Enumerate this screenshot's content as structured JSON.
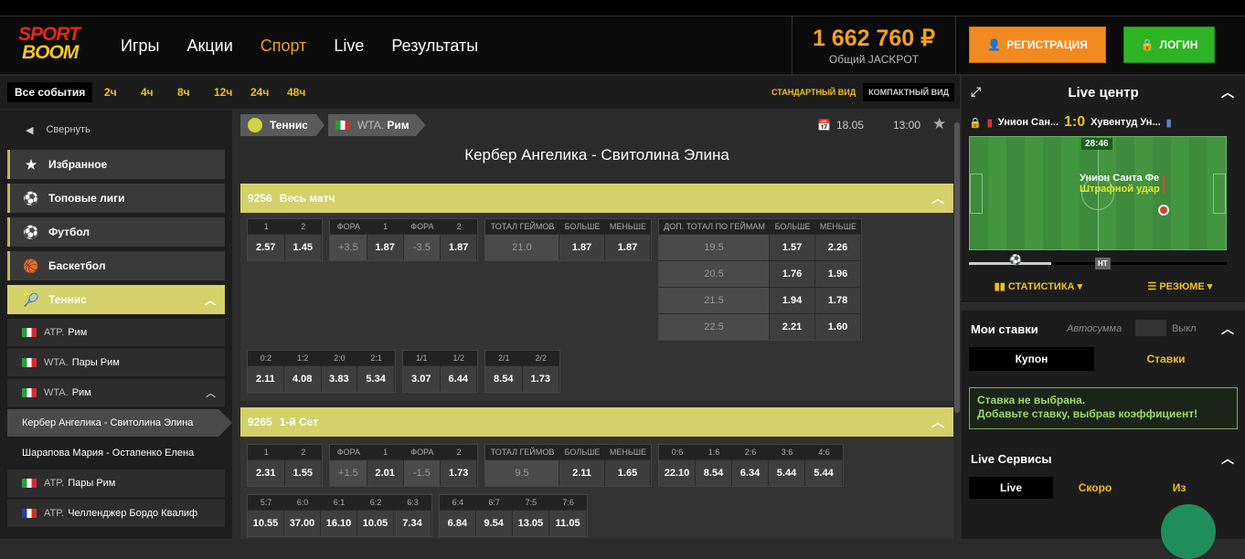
{
  "brand": {
    "line1": "SPORT",
    "line2": "BOOM"
  },
  "nav": {
    "items": [
      {
        "label": "Игры",
        "active": false
      },
      {
        "label": "Акции",
        "active": false
      },
      {
        "label": "Спорт",
        "active": true
      },
      {
        "label": "Live",
        "active": false
      },
      {
        "label": "Результаты",
        "active": false
      }
    ]
  },
  "jackpot": {
    "amount": "1 662 760 ₽",
    "label": "Общий JACKPOT"
  },
  "auth": {
    "register": "РЕГИСТРАЦИЯ",
    "login": "ЛОГИН"
  },
  "filter": {
    "all": "Все события",
    "hours": [
      "2ч",
      "4ч",
      "8ч",
      "12ч",
      "24ч",
      "48ч"
    ],
    "std_view": "СТАНДАРТНЫЙ ВИД",
    "compact_view": "КОМПАКТНЫЙ ВИД"
  },
  "sidebar": {
    "collapse": "Свернуть",
    "items": [
      {
        "label": "Избранное",
        "icon": "star-icon"
      },
      {
        "label": "Топовые лиги",
        "icon": "soccer-ball-icon"
      },
      {
        "label": "Футбол",
        "icon": "soccer-ball-icon"
      },
      {
        "label": "Баскетбол",
        "icon": "basketball-icon"
      },
      {
        "label": "Теннис",
        "icon": "tennis-ball-icon"
      }
    ],
    "sub": [
      {
        "pre": "ATP.",
        "label": "Рим"
      },
      {
        "pre": "WTA.",
        "label": "Пары Рим"
      },
      {
        "pre": "WTA.",
        "label": "Рим"
      }
    ],
    "matches": [
      "Кербер Ангелика - Свитолина Элина",
      "Шарапова Мария - Остапенко Елена"
    ],
    "sub2": [
      {
        "pre": "ATP.",
        "label": "Пары Рим"
      },
      {
        "pre": "ATP.",
        "label": "Челленджер Бордо Квалиф"
      }
    ]
  },
  "match": {
    "crumb_sport": "Теннис",
    "crumb_league_pre": "WTA.",
    "crumb_league": "Рим",
    "date": "18.05",
    "time": "13:00",
    "title": "Кербер Ангелика - Свитолина Элина",
    "markets": [
      {
        "id": "9256",
        "name": "Весь матч"
      },
      {
        "id": "9265",
        "name": "1-й Сет"
      }
    ]
  },
  "m1": {
    "g1": {
      "h": [
        "1",
        "2"
      ],
      "v": [
        "2.57",
        "1.45"
      ]
    },
    "g2": {
      "h": [
        "ФОРА",
        "1",
        "ФОРА",
        "2"
      ],
      "v": [
        "+3.5",
        "1.87",
        "-3.5",
        "1.87"
      ]
    },
    "g3": {
      "h": [
        "ТОТАЛ ГЕЙМОВ",
        "БОЛЬШЕ",
        "МЕНЬШЕ"
      ],
      "v": [
        "21.0",
        "1.87",
        "1.87"
      ]
    },
    "g4": {
      "h": [
        "ДОП. ТОТАЛ ПО ГЕЙМАМ",
        "БОЛЬШЕ",
        "МЕНЬШЕ"
      ],
      "rows": [
        [
          "19.5",
          "1.57",
          "2.26"
        ],
        [
          "20.5",
          "1.76",
          "1.96"
        ],
        [
          "21.5",
          "1.94",
          "1.78"
        ],
        [
          "22.5",
          "2.21",
          "1.60"
        ]
      ]
    },
    "g5": {
      "h": [
        "0:2",
        "1:2",
        "2:0",
        "2:1"
      ],
      "v": [
        "2.11",
        "4.08",
        "3.83",
        "5.34"
      ]
    },
    "g6": {
      "h": [
        "1/1",
        "1/2"
      ],
      "v": [
        "3.07",
        "6.44"
      ]
    },
    "g7": {
      "h": [
        "2/1",
        "2/2"
      ],
      "v": [
        "8.54",
        "1.73"
      ]
    }
  },
  "m2": {
    "g1": {
      "h": [
        "1",
        "2"
      ],
      "v": [
        "2.31",
        "1.55"
      ]
    },
    "g2": {
      "h": [
        "ФОРА",
        "1",
        "ФОРА",
        "2"
      ],
      "v": [
        "+1.5",
        "2.01",
        "-1.5",
        "1.73"
      ]
    },
    "g3": {
      "h": [
        "ТОТАЛ ГЕЙМОВ",
        "БОЛЬШЕ",
        "МЕНЬШЕ"
      ],
      "v": [
        "9.5",
        "2.11",
        "1.65"
      ]
    },
    "g4": {
      "h": [
        "0:6",
        "1:6",
        "2:6",
        "3:6",
        "4:6"
      ],
      "v": [
        "22.10",
        "8.54",
        "6.34",
        "5.44",
        "5.44"
      ]
    },
    "g5": {
      "h": [
        "5:7",
        "6:0",
        "6:1",
        "6:2",
        "6:3"
      ],
      "v": [
        "10.55",
        "37.00",
        "16.10",
        "10.05",
        "7.34"
      ]
    },
    "g6": {
      "h": [
        "6:4",
        "6:7",
        "7:5",
        "7:6"
      ],
      "v": [
        "6.84",
        "9.54",
        "13.05",
        "11.05"
      ]
    }
  },
  "live": {
    "title": "Live центр",
    "home": "Унион Сан...",
    "away": "Хувентуд Ун...",
    "score": "1:0",
    "timer": "28:46",
    "event_team": "Унион Санта Фе",
    "event": "Штрафной удар",
    "half": "HT",
    "stats": "СТАТИСТИКА",
    "summary": "РЕЗЮМЕ"
  },
  "bets": {
    "title": "Мои ставки",
    "auto": "Автосумма",
    "off": "Выкл",
    "coupon": "Купон",
    "bets": "Ставки",
    "note1": "Ставка не выбрана.",
    "note2": "Добавьте ставку, выбрав коэффициент!"
  },
  "services": {
    "title": "Live Сервисы",
    "tabs": [
      "Live",
      "Скоро",
      "Из"
    ]
  }
}
